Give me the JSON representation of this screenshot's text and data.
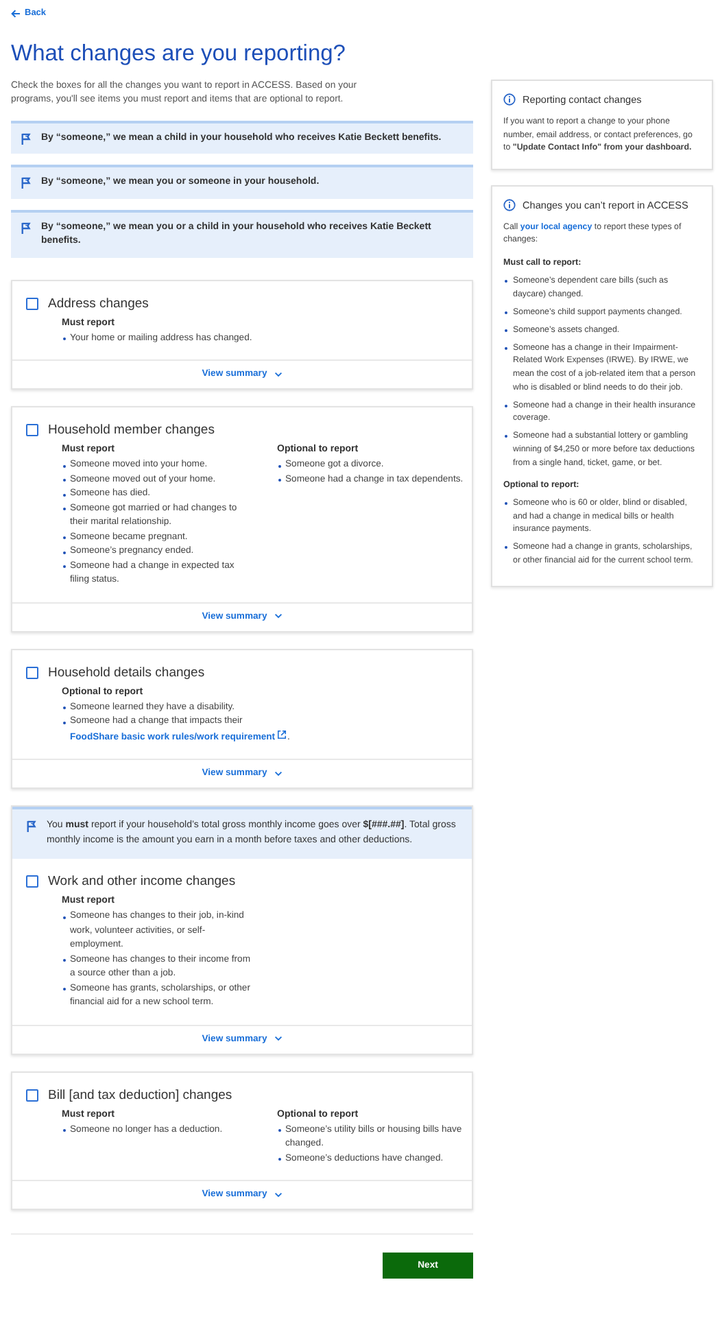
{
  "back_link": "Back",
  "title": "What changes are you reporting?",
  "intro": "Check the boxes for all the changes you want to report in ACCESS. Based on your programs, you'll see items you must report and items that are optional to report.",
  "notices": [
    {
      "text": "By “someone,” we mean a child in your household who receives Katie Beckett benefits."
    },
    {
      "text": "By “someone,” we mean you or someone in your household."
    },
    {
      "text": "By “someone,” we mean you or a child in your household who receives Katie Beckett benefits."
    }
  ],
  "cards": [
    {
      "title": "Address changes",
      "checked": false,
      "sections": [
        {
          "heading": "Must report",
          "items": [
            "Your home or mailing address has changed."
          ]
        }
      ],
      "summary_link": "View summary"
    },
    {
      "title": "Household member changes",
      "checked": false,
      "sections": [
        {
          "heading": "Must report",
          "items": [
            "Someone moved into your home.",
            "Someone moved out of your home.",
            "Someone has died.",
            "Someone got married or had changes to their marital relationship.",
            "Someone became pregnant.",
            "Someone’s pregnancy ended.",
            "Someone had a change in expected tax filing status."
          ]
        },
        {
          "heading": "Optional to report",
          "items": [
            "Someone got a divorce.",
            "Someone had a change in tax dependents."
          ]
        }
      ],
      "summary_link": "View summary"
    },
    {
      "title": "Household details changes",
      "checked": false,
      "sections": [
        {
          "heading": "Optional to report",
          "items": [
            "Someone learned they have a disability.",
            {
              "text": "Someone had a change that impacts their",
              "link": "FoodShare basic work rules/work requirement",
              "after": "."
            }
          ]
        }
      ],
      "summary_link": "View summary"
    },
    {
      "title": "Work and other income changes",
      "checked": false,
      "notice": "You **must** report if your household’s total gross monthly income goes over **$[###.##]**. Total gross monthly income is the amount you earn in a month before taxes and other deductions.",
      "sections": [
        {
          "heading": "Must report",
          "items": [
            "Someone has changes to their job, in-kind work, volunteer activities, or self-employment.",
            "Someone has changes to their income from a source other than a job.",
            "Someone has grants, scholarships, or other financial aid for a new school term."
          ]
        }
      ],
      "summary_link": "View summary"
    },
    {
      "title": "Bill [and tax deduction] changes",
      "checked": false,
      "sections": [
        {
          "heading": "Must report",
          "items": [
            "Someone no longer has a deduction."
          ]
        },
        {
          "heading": "Optional to report",
          "items": [
            "Someone’s utility bills or housing bills have changed.",
            "Someone’s deductions have changed."
          ]
        }
      ],
      "summary_link": "View summary"
    }
  ],
  "next_button": "Next",
  "sidebar": {
    "contact_card": {
      "title": "Reporting contact changes",
      "body": "If you want to report a change to your phone number, email address, or contact preferences, go to **\"Update Contact Info\" from your dashboard.**"
    },
    "agency_card": {
      "title": "Changes you can’t report in ACCESS",
      "intro_before": "Call",
      "intro_link": "your local agency",
      "intro_after": "to report these types of changes:",
      "sections": [
        {
          "heading": "Must call to report:",
          "items": [
            "Someone’s dependent care bills (such as daycare) changed.",
            "Someone’s child support payments changed.",
            "Someone’s assets changed.",
            "Someone has a change in their Impairment-Related Work Expenses (IRWE). By IRWE, we mean the cost of a job-related item that a person who is disabled or blind needs to do their job.",
            "Someone had a change in their health insurance coverage.",
            "Someone had a substantial lottery or gambling winning of $4,250 or more before tax deductions from a single hand, ticket, game, or bet."
          ]
        },
        {
          "heading": "Optional to report:",
          "items": [
            "Someone who is 60 or older, blind or disabled, and had a change in medical bills or health insurance payments.",
            "Someone had a change in grants, scholarships, or other financial aid for the current school term."
          ]
        }
      ]
    }
  }
}
